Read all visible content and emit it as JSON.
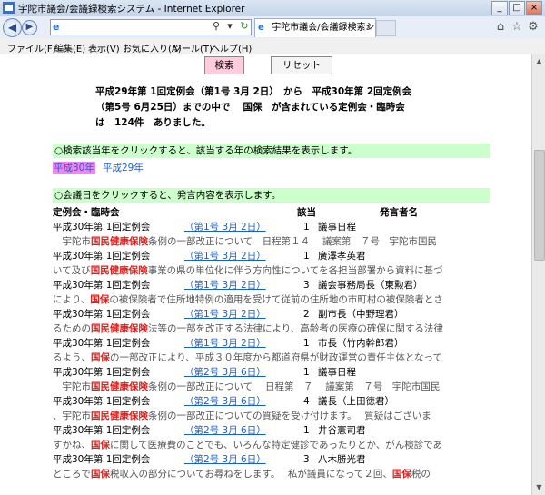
{
  "window": {
    "title": "宇陀市議会/会議録検索システム - Internet Explorer",
    "minimize": "_",
    "restore": "□",
    "close": "×"
  },
  "browser": {
    "tab_title": "宇陀市議会/会議録検索シ...",
    "search_icon": "⚲",
    "refresh_icon": "↻",
    "menu": [
      "ファイル(F)",
      "編集(E)",
      "表示(V)",
      "お気に入り(A)",
      "ツール(T)",
      "ヘルプ(H)"
    ]
  },
  "page": {
    "search_button": "検索",
    "reset_button": "リセット",
    "summary_lines": [
      "平成29年第 1回定例会（第1号 3月 2日）　から　平成30年第 2回定例会",
      "（第5号 6月25日）までの中で　 国保　が含まれている定例会・臨時会",
      "は　124件　ありました。"
    ],
    "year_hint": "○検索該当年をクリックすると、該当する年の検索結果を表示します。",
    "years": [
      "平成30年",
      "平成29年"
    ],
    "day_hint": "○会議日をクリックすると、発言内容を表示します。",
    "columns": {
      "session": "定例会・臨時会",
      "match": "該当",
      "speaker": "発言者名"
    },
    "rows": [
      {
        "session": "平成30年第 1回定例会",
        "date": "（第1号 3月 2日）",
        "count": "1",
        "speaker": "議事日程",
        "excerpt": [
          {
            "t": "　宇陀市"
          },
          {
            "t": "国民健康保険",
            "hl": true
          },
          {
            "t": "条例の一部改正について　日程第１４　 議案第　７号　宇陀市国民"
          }
        ]
      },
      {
        "session": "平成30年第 1回定例会",
        "date": "（第1号 3月 2日）",
        "count": "1",
        "speaker": "廣澤孝英君",
        "excerpt": [
          {
            "t": "いて及び"
          },
          {
            "t": "国民健康保険",
            "hl": true
          },
          {
            "t": "事業の県の単位化に伴う方向性についてを各担当部署から資料に基づ"
          }
        ]
      },
      {
        "session": "平成30年第 1回定例会",
        "date": "（第1号 3月 2日）",
        "count": "3",
        "speaker": "議会事務局長（東勲君）",
        "excerpt": [
          {
            "t": "により、"
          },
          {
            "t": "国保",
            "hl": true
          },
          {
            "t": "の被保険者で住所地特例の適用を受けて従前の住所地の市町村の被保険者とさ"
          }
        ]
      },
      {
        "session": "平成30年第 1回定例会",
        "date": "（第1号 3月 2日）",
        "count": "2",
        "speaker": "副市長（中野理君）",
        "excerpt": [
          {
            "t": "るための"
          },
          {
            "t": "国民健康保険",
            "hl": true
          },
          {
            "t": "法等の一部を改正する法律により、高齢者の医療の確保に関する法律"
          }
        ]
      },
      {
        "session": "平成30年第 1回定例会",
        "date": "（第1号 3月 2日）",
        "count": "1",
        "speaker": "市長（竹内幹郎君）",
        "excerpt": [
          {
            "t": "るよう、"
          },
          {
            "t": "国保",
            "hl": true
          },
          {
            "t": "の一部改正により、平成３０年度から都道府県が財政運営の責任主体となって"
          }
        ]
      },
      {
        "session": "平成30年第 1回定例会",
        "date": "（第2号 3月 6日）",
        "count": "1",
        "speaker": "議事日程",
        "excerpt": [
          {
            "t": "　宇陀市"
          },
          {
            "t": "国民健康保険",
            "hl": true
          },
          {
            "t": "条例の一部改正について　 日程第　７　 議案第　７号　宇陀市国民"
          }
        ]
      },
      {
        "session": "平成30年第 1回定例会",
        "date": "（第2号 3月 6日）",
        "count": "4",
        "speaker": "議長（上田徳君）",
        "excerpt": [
          {
            "t": "、宇陀市"
          },
          {
            "t": "国民健康保険",
            "hl": true
          },
          {
            "t": "条例の一部改正についての質疑を受け付けます。　 質疑はございま"
          }
        ]
      },
      {
        "session": "平成30年第 1回定例会",
        "date": "（第2号 3月 6日）",
        "count": "1",
        "speaker": "井谷憲司君",
        "excerpt": [
          {
            "t": "すかね、"
          },
          {
            "t": "国保",
            "hl": true
          },
          {
            "t": "に関して医療費のことでも、いろんな特定健診であったりとか、がん検診であ"
          }
        ]
      },
      {
        "session": "平成30年第 1回定例会",
        "date": "（第2号 3月 6日）",
        "count": "3",
        "speaker": "八木勝光君",
        "excerpt": [
          {
            "t": "ところで"
          },
          {
            "t": "国保",
            "hl": true
          },
          {
            "t": "税収入の部分についてお尋ねをします。　 私が議員になって２回、"
          },
          {
            "t": "国保",
            "hl": true
          },
          {
            "t": "税の"
          }
        ]
      }
    ]
  },
  "colors": {
    "highlight": "#e0201a",
    "hint_bg": "#ccffcc",
    "link": "#1a5fd0",
    "search_btn_bg": "#ffccdd",
    "active_year_bg": "#ee88ee"
  }
}
